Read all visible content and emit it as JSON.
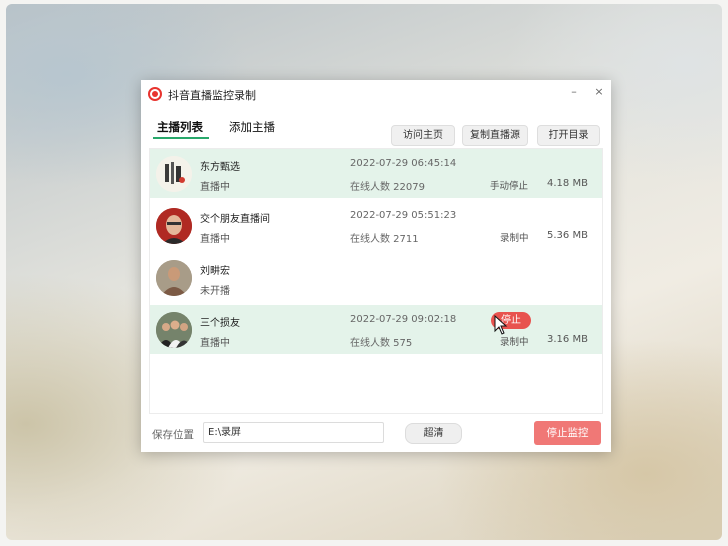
{
  "window": {
    "title": "抖音直播监控录制",
    "minimize_glyph": "–",
    "close_glyph": "×"
  },
  "tabs": [
    {
      "label": "主播列表",
      "active": true
    },
    {
      "label": "添加主播",
      "active": false
    }
  ],
  "toolbar": {
    "visit_home": "访问主页",
    "copy_stream": "复制直播源",
    "open_folder": "打开目录"
  },
  "streamers": [
    {
      "name": "东方甄选",
      "status": "直播中",
      "time": "2022-07-29 06:45:14",
      "viewers": "在线人数 22079",
      "state": "手动停止",
      "size": "4.18 MB",
      "highlighted": true
    },
    {
      "name": "交个朋友直播间",
      "status": "直播中",
      "time": "2022-07-29 05:51:23",
      "viewers": "在线人数 2711",
      "state": "录制中",
      "size": "5.36 MB",
      "highlighted": false
    },
    {
      "name": "刘畊宏",
      "status": "未开播",
      "time": "",
      "viewers": "",
      "state": "",
      "size": "",
      "highlighted": false
    },
    {
      "name": "三个损友",
      "status": "直播中",
      "time": "2022-07-29 09:02:18",
      "viewers": "在线人数 575",
      "state": "录制中",
      "size": "3.16 MB",
      "highlighted": true,
      "action_button": "停止"
    }
  ],
  "footer": {
    "save_label": "保存位置",
    "save_path": "E:\\录屏",
    "clear_button": "超清",
    "stop_monitor_button": "停止监控"
  },
  "colors": {
    "accent_green": "#28a86b",
    "row_highlight": "#e4f3ea",
    "record_red": "#e8342f",
    "stop_button": "#f07876"
  }
}
